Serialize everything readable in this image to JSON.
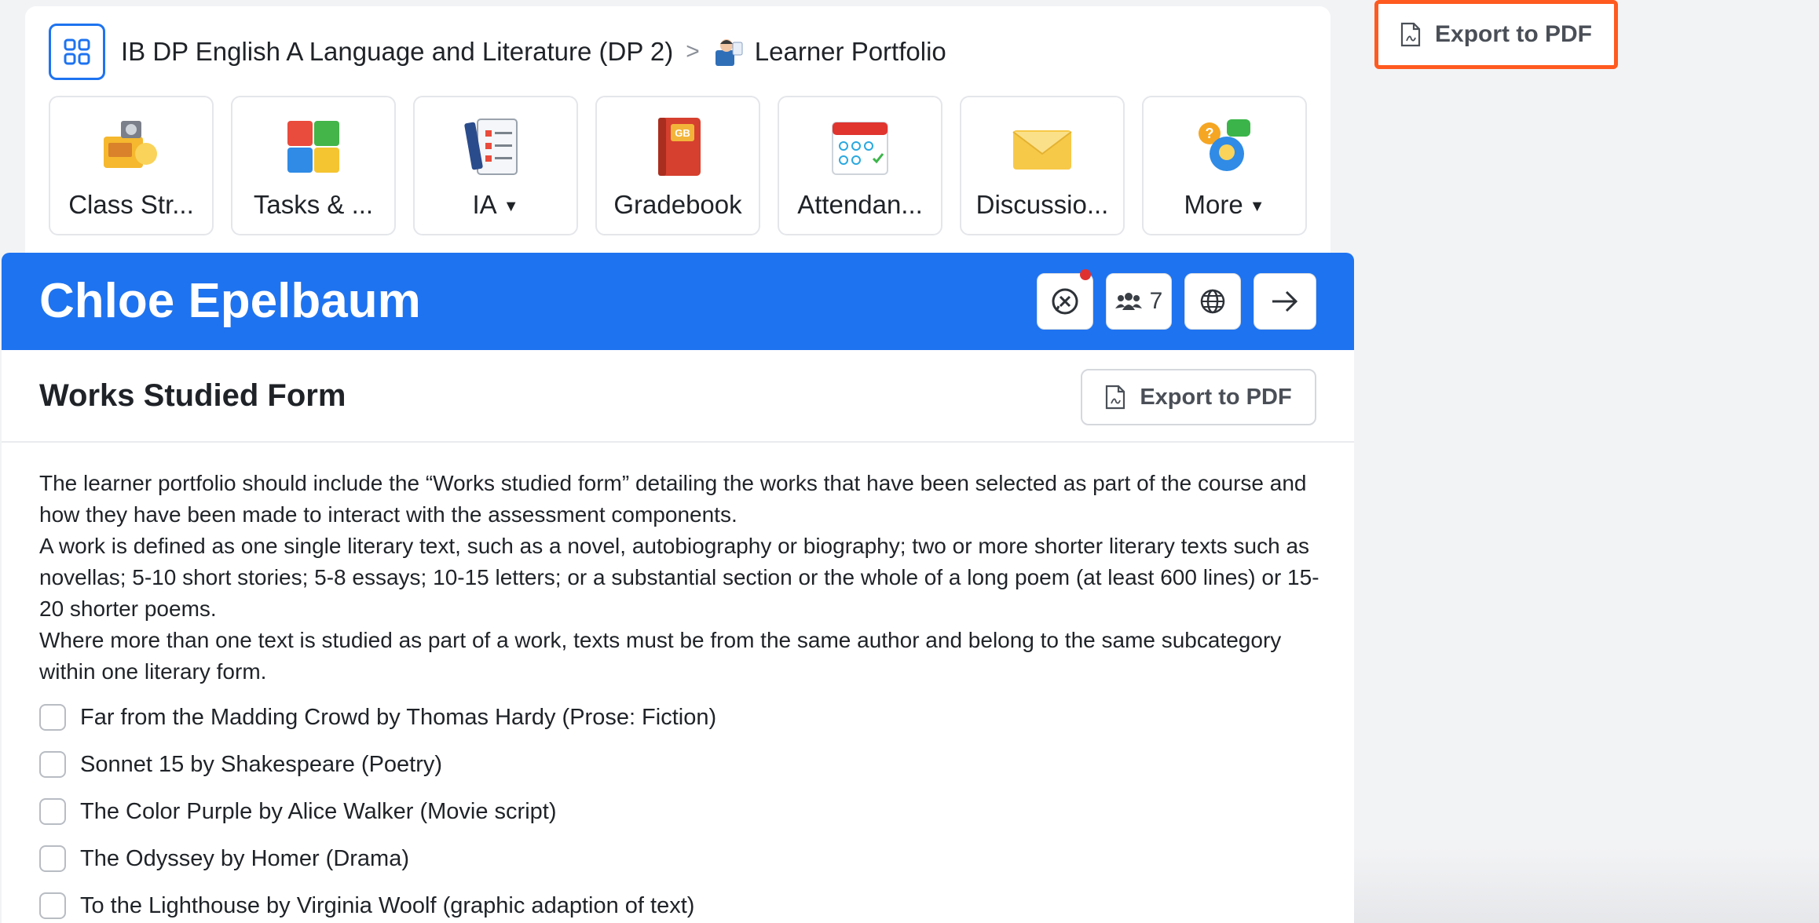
{
  "breadcrumb": {
    "course": "IB DP English A Language and Literature (DP 2)",
    "separator": ">",
    "page": "Learner Portfolio",
    "apps_icon": "grid-icon",
    "page_icon": "learner-portfolio-icon"
  },
  "tiles": [
    {
      "label": "Class Str...",
      "icon": "class-stream-icon"
    },
    {
      "label": "Tasks & ...",
      "icon": "puzzle-icon"
    },
    {
      "label": "IA",
      "icon": "checklist-icon",
      "dropdown": true
    },
    {
      "label": "Gradebook",
      "icon": "gradebook-icon"
    },
    {
      "label": "Attendan...",
      "icon": "attendance-calendar-icon"
    },
    {
      "label": "Discussio...",
      "icon": "envelope-icon"
    },
    {
      "label": "More",
      "icon": "chat-bubbles-icon",
      "dropdown": true
    }
  ],
  "top_export": {
    "label": "Export to PDF",
    "icon": "pdf-file-icon",
    "highlight_color": "#ff5a1f"
  },
  "student": {
    "name": "Chloe Epelbaum",
    "members_count": "7",
    "icons": [
      "chat-notification-icon",
      "group-icon",
      "globe-icon",
      "arrow-right-icon"
    ]
  },
  "form": {
    "title": "Works Studied Form",
    "export_label": "Export to PDF",
    "description": [
      "The learner portfolio should include the “Works studied form” detailing the works that have been selected as part of the course and how they have been made to interact with the assessment components.",
      "A work is defined as one single literary text, such as a novel, autobiography or biography; two or more shorter literary texts such as novellas; 5-10 short stories; 5-8 essays; 10-15 letters; or a substantial section or the whole of a long poem (at least 600 lines) or 15-20 shorter poems.",
      "Where more than one text is studied as part of a work, texts must be from the same author and belong to the same subcategory within one literary form."
    ],
    "works": [
      "Far from the Madding Crowd by Thomas Hardy (Prose: Fiction)",
      "Sonnet 15 by Shakespeare (Poetry)",
      "The Color Purple by Alice Walker (Movie script)",
      "The Odyssey by Homer (Drama)",
      "To the Lighthouse by Virginia Woolf (graphic adaption of text)"
    ]
  },
  "colors": {
    "primary": "#1e73f0",
    "notification": "#e03131"
  }
}
